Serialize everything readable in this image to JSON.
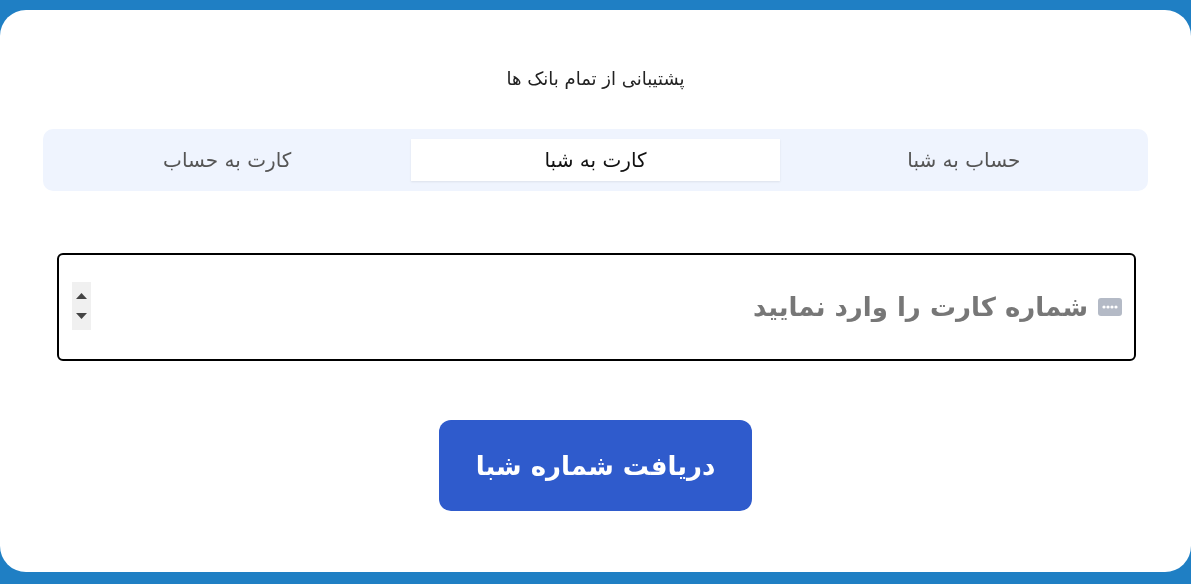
{
  "subtitle": "پشتیبانی از تمام بانک ها",
  "tabs": [
    {
      "label": "حساب به شبا",
      "selected": false
    },
    {
      "label": "کارت به شبا",
      "selected": true
    },
    {
      "label": "کارت به حساب",
      "selected": false
    }
  ],
  "card_field": {
    "placeholder": "شماره کارت را وارد نمایید"
  },
  "submit_button": "دریافت شماره شبا"
}
